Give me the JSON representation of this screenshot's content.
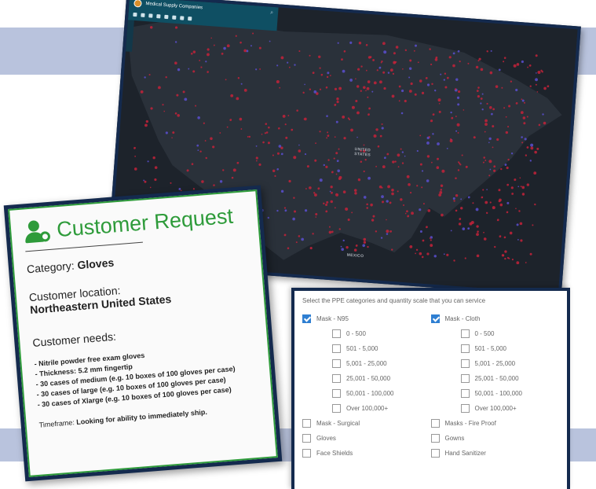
{
  "map": {
    "app_title": "Medical Supply Companies",
    "search_icon": "search-icon",
    "labels": {
      "united_states": "UNITED\nSTATES",
      "mexico": "MEXICO"
    },
    "colors": {
      "background": "#232a33",
      "dot_primary": "#c4223a",
      "dot_secondary": "#5a4fd0",
      "toolbar": "#0f4f63"
    }
  },
  "request": {
    "title": "Customer Request",
    "title_icon": "user-shield-icon",
    "category_label": "Category: ",
    "category_value": "Gloves",
    "location_label": "Customer location:",
    "location_value": "Northeastern United States",
    "needs_label": "Customer needs:",
    "needs": [
      "- Nitrile powder free exam gloves",
      "- Thickness: 5.2 mm fingertip",
      "- 30 cases of medium (e.g. 10 boxes of 100 gloves per case)",
      "- 30 cases of large (e.g. 10 boxes of 100 gloves per case)",
      "- 30 cases of Xlarge (e.g. 10 boxes of 100 gloves per case)"
    ],
    "timeframe_label": "Timeframe: ",
    "timeframe_value": "Looking for ability to immediately ship.",
    "accent_color": "#2e9b3a"
  },
  "ppe_form": {
    "intro": "Select the PPE categories and quantity scale that you can service",
    "left": [
      {
        "label": "Mask - N95",
        "checked": true,
        "indent": false
      },
      {
        "label": "0 - 500",
        "checked": false,
        "indent": true
      },
      {
        "label": "501 - 5,000",
        "checked": false,
        "indent": true
      },
      {
        "label": "5,001 - 25,000",
        "checked": false,
        "indent": true
      },
      {
        "label": "25,001 - 50,000",
        "checked": false,
        "indent": true
      },
      {
        "label": "50,001 - 100,000",
        "checked": false,
        "indent": true
      },
      {
        "label": "Over 100,000+",
        "checked": false,
        "indent": true
      },
      {
        "label": "Mask - Surgical",
        "checked": false,
        "indent": false
      },
      {
        "label": "Gloves",
        "checked": false,
        "indent": false
      },
      {
        "label": "Face Shields",
        "checked": false,
        "indent": false
      }
    ],
    "right": [
      {
        "label": "Mask - Cloth",
        "checked": true,
        "indent": false
      },
      {
        "label": "0 - 500",
        "checked": false,
        "indent": true
      },
      {
        "label": "501 - 5,000",
        "checked": false,
        "indent": true
      },
      {
        "label": "5,001 - 25,000",
        "checked": false,
        "indent": true
      },
      {
        "label": "25,001 - 50,000",
        "checked": false,
        "indent": true
      },
      {
        "label": "50,001 - 100,000",
        "checked": false,
        "indent": true
      },
      {
        "label": "Over 100,000+",
        "checked": false,
        "indent": true
      },
      {
        "label": "Masks - Fire Proof",
        "checked": false,
        "indent": false
      },
      {
        "label": "Gowns",
        "checked": false,
        "indent": false
      },
      {
        "label": "Hand Sanitizer",
        "checked": false,
        "indent": false
      }
    ],
    "check_color": "#2f7fd2"
  }
}
